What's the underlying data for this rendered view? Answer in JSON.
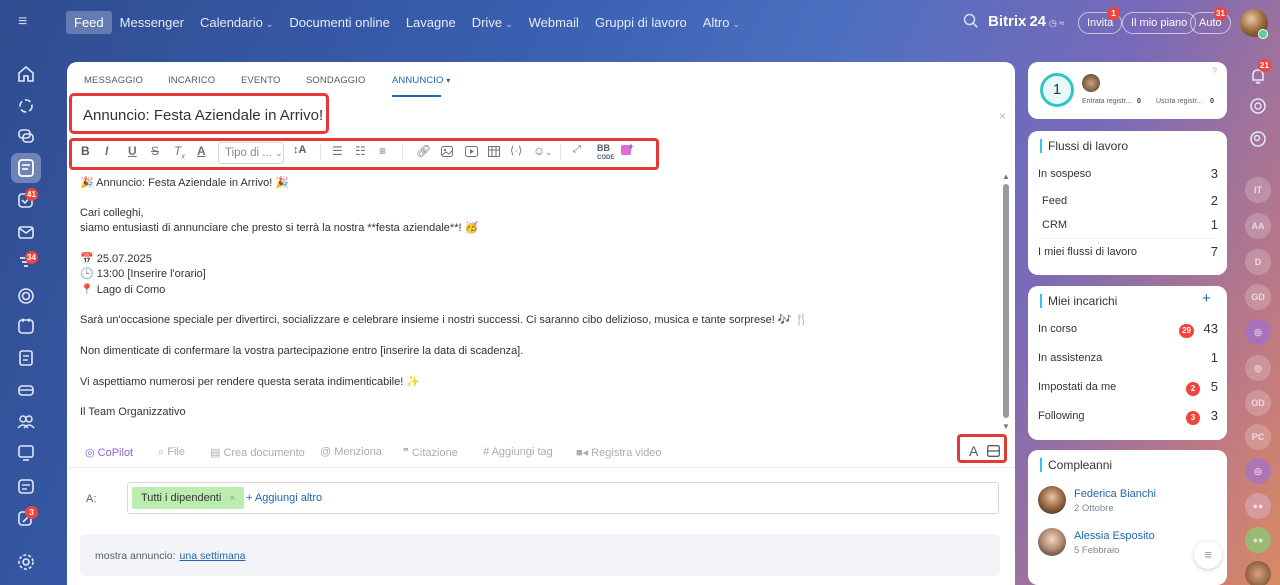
{
  "topbar": {
    "nav": [
      {
        "label": "Feed",
        "active": true,
        "dropdown": false
      },
      {
        "label": "Messenger",
        "active": false,
        "dropdown": false
      },
      {
        "label": "Calendario",
        "active": false,
        "dropdown": true
      },
      {
        "label": "Documenti online",
        "active": false,
        "dropdown": false
      },
      {
        "label": "Lavagne",
        "active": false,
        "dropdown": false
      },
      {
        "label": "Drive",
        "active": false,
        "dropdown": true
      },
      {
        "label": "Webmail",
        "active": false,
        "dropdown": false
      },
      {
        "label": "Gruppi di lavoro",
        "active": false,
        "dropdown": false
      },
      {
        "label": "Altro",
        "active": false,
        "dropdown": true
      }
    ],
    "brand": "Bitrix",
    "brand_num": "24",
    "invite": {
      "label": "Invita",
      "badge": "1"
    },
    "plan_label": "Il mio piano",
    "auto": {
      "label": "Auto",
      "badge": "31"
    }
  },
  "leftbar": {
    "badges": {
      "tasks": "41",
      "filter": "34",
      "approvals": "3"
    }
  },
  "rightbar": {
    "notif_badge": "21",
    "avatars": [
      "IT",
      "AA",
      "D",
      "GD",
      "OD",
      "PC"
    ]
  },
  "composer": {
    "tabs": [
      "MESSAGGIO",
      "INCARICO",
      "EVENTO",
      "SONDAGGIO",
      "ANNUNCIO"
    ],
    "active_tab": "ANNUNCIO",
    "title": "Annuncio: Festa Aziendale in Arrivo!",
    "tipo_label": "Tipo di ...",
    "body": {
      "line1": "🎉 Annuncio: Festa Aziendale in Arrivo! 🎉",
      "line2": "Cari colleghi,",
      "line3": "siamo entusiasti di annunciare che presto si terrà la nostra **festa aziendale**! 🥳",
      "line4": "📅 25.07.2025",
      "line5": "🕒 13:00 [Inserire l'orario]",
      "line6": "📍 Lago di Como",
      "line7": "Sarà un'occasione speciale per divertirci, socializzare e celebrare insieme i nostri successi. Ci saranno cibo delizioso, musica e tante sorprese! 🎶 🍴",
      "line8": "Non dimenticate di confermare la vostra partecipazione entro [inserire la data di scadenza].",
      "line9": "Vi aspettiamo numerosi per rendere questa serata indimenticabile! ✨",
      "line10": "Il Team Organizzativo"
    },
    "bottom_tools": [
      "CoPilot",
      "File",
      "Crea documento",
      "Menziona",
      "Citazione",
      "Aggiungi tag",
      "Registra video"
    ],
    "to_label": "A:",
    "recipient": "Tutti i dipendenti",
    "add_more": "+ Aggiungi altro",
    "show_label": "mostra annuncio:",
    "show_value": "una settimana"
  },
  "widgets": {
    "timeman": {
      "circle": "1",
      "entrata": "Entrata registr...",
      "entrata_v": "0",
      "uscita": "Uscita registr...",
      "uscita_v": "0"
    },
    "workflows": {
      "title": "Flussi di lavoro",
      "rows": [
        {
          "label": "In sospeso",
          "value": "3"
        },
        {
          "label": "Feed",
          "value": "2"
        },
        {
          "label": "CRM",
          "value": "1"
        },
        {
          "label": "I miei flussi di lavoro",
          "value": "7"
        }
      ]
    },
    "tasks": {
      "title": "Miei incarichi",
      "add": "+",
      "rows": [
        {
          "label": "In corso",
          "badge": "29",
          "value": "43"
        },
        {
          "label": "In assistenza",
          "badge": "",
          "value": "1"
        },
        {
          "label": "Impostati da me",
          "badge": "2",
          "value": "5"
        },
        {
          "label": "Following",
          "badge": "3",
          "value": "3"
        }
      ]
    },
    "birthdays": {
      "title": "Compleanni",
      "people": [
        {
          "name": "Federica Bianchi",
          "date": "2 Ottobre"
        },
        {
          "name": "Alessia Esposito",
          "date": "5 Febbraio"
        }
      ]
    }
  }
}
